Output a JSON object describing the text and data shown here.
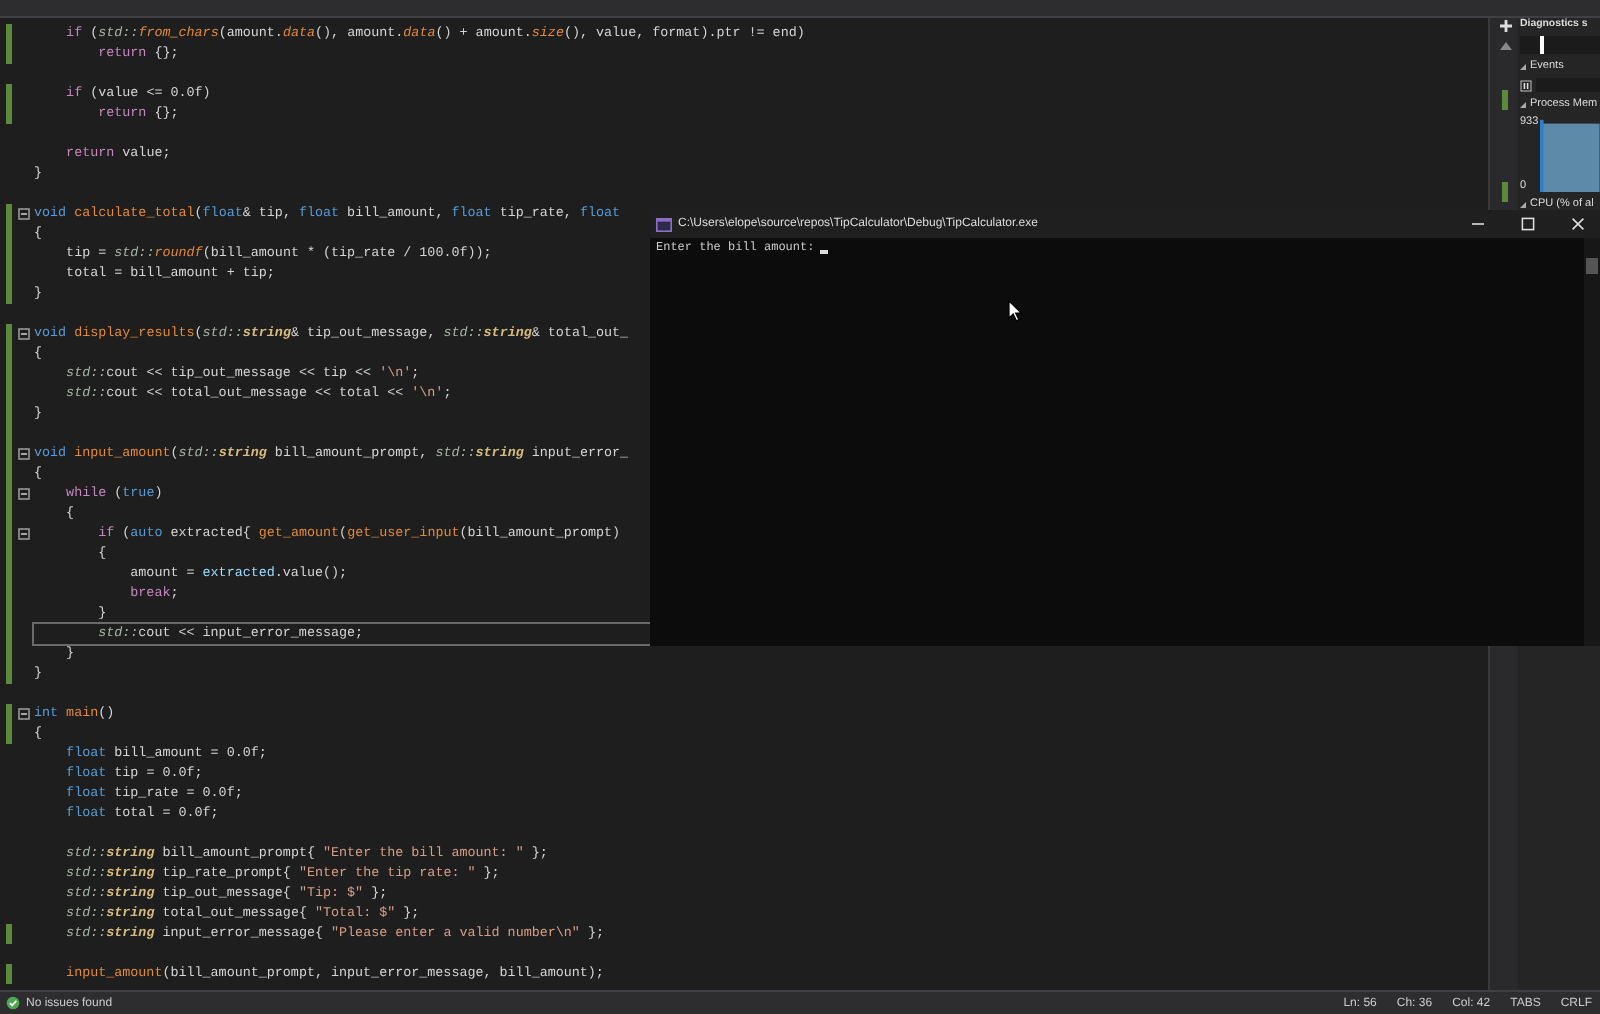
{
  "editor": {
    "lines": [
      {
        "changed": true,
        "fold": false,
        "current": false,
        "segs": [
          {
            "kind": "c",
            "text": "    if"
          },
          {
            "kind": "p",
            "text": " ("
          },
          {
            "kind": "n",
            "text": "std::"
          },
          {
            "kind": "m",
            "text": "from_chars"
          },
          {
            "kind": "p",
            "text": "(amount."
          },
          {
            "kind": "m",
            "text": "data"
          },
          {
            "kind": "p",
            "text": "(), amount."
          },
          {
            "kind": "m",
            "text": "data"
          },
          {
            "kind": "p",
            "text": "() + amount."
          },
          {
            "kind": "m",
            "text": "size"
          },
          {
            "kind": "p",
            "text": "(), value, format).ptr != end)"
          }
        ]
      },
      {
        "changed": true,
        "fold": false,
        "current": false,
        "segs": [
          {
            "kind": "c",
            "text": "        return"
          },
          {
            "kind": "p",
            "text": " {};"
          }
        ]
      },
      {
        "changed": false,
        "fold": false,
        "current": false
      },
      {
        "changed": true,
        "fold": false,
        "current": false,
        "segs": [
          {
            "kind": "c",
            "text": "    if"
          },
          {
            "kind": "p",
            "text": " (value <= 0.0f)"
          }
        ]
      },
      {
        "changed": true,
        "fold": false,
        "current": false,
        "segs": [
          {
            "kind": "c",
            "text": "        return"
          },
          {
            "kind": "p",
            "text": " {};"
          }
        ]
      },
      {
        "changed": false,
        "fold": false,
        "current": false
      },
      {
        "changed": false,
        "fold": false,
        "current": false,
        "segs": [
          {
            "kind": "c",
            "text": "    return"
          },
          {
            "kind": "p",
            "text": " value;"
          }
        ]
      },
      {
        "changed": false,
        "fold": false,
        "current": false,
        "segs": [
          {
            "kind": "p",
            "text": "}"
          }
        ]
      },
      {
        "changed": false,
        "fold": false,
        "current": false
      },
      {
        "changed": true,
        "fold": true,
        "current": false,
        "segs": [
          {
            "kind": "k",
            "text": "void"
          },
          {
            "kind": "f",
            "text": " calculate_total"
          },
          {
            "kind": "p",
            "text": "("
          },
          {
            "kind": "k",
            "text": "float"
          },
          {
            "kind": "p",
            "text": "& tip, "
          },
          {
            "kind": "k",
            "text": "float"
          },
          {
            "kind": "p",
            "text": " bill_amount, "
          },
          {
            "kind": "k",
            "text": "float"
          },
          {
            "kind": "p",
            "text": " tip_rate, "
          },
          {
            "kind": "k",
            "text": "float"
          }
        ]
      },
      {
        "changed": true,
        "fold": false,
        "current": false,
        "segs": [
          {
            "kind": "p",
            "text": "{"
          }
        ]
      },
      {
        "changed": true,
        "fold": false,
        "current": false,
        "segs": [
          {
            "kind": "p",
            "text": "    tip = "
          },
          {
            "kind": "n",
            "text": "std::"
          },
          {
            "kind": "m",
            "text": "roundf"
          },
          {
            "kind": "p",
            "text": "(bill_amount * (tip_rate / 100.0f));"
          }
        ]
      },
      {
        "changed": true,
        "fold": false,
        "current": false,
        "segs": [
          {
            "kind": "p",
            "text": "    total = bill_amount + tip;"
          }
        ]
      },
      {
        "changed": true,
        "fold": false,
        "current": false,
        "segs": [
          {
            "kind": "p",
            "text": "}"
          }
        ]
      },
      {
        "changed": false,
        "fold": false,
        "current": false
      },
      {
        "changed": true,
        "fold": true,
        "current": false,
        "segs": [
          {
            "kind": "k",
            "text": "void"
          },
          {
            "kind": "f",
            "text": " display_results"
          },
          {
            "kind": "p",
            "text": "("
          },
          {
            "kind": "n",
            "text": "std::"
          },
          {
            "kind": "t",
            "text": "string"
          },
          {
            "kind": "p",
            "text": "& tip_out_message, "
          },
          {
            "kind": "n",
            "text": "std::"
          },
          {
            "kind": "t",
            "text": "string"
          },
          {
            "kind": "p",
            "text": "& total_out_"
          }
        ]
      },
      {
        "changed": true,
        "fold": false,
        "current": false,
        "segs": [
          {
            "kind": "p",
            "text": "{"
          }
        ]
      },
      {
        "changed": true,
        "fold": false,
        "current": false,
        "segs": [
          {
            "kind": "n",
            "text": "    std::"
          },
          {
            "kind": "p",
            "text": "cout << tip_out_message << tip << "
          },
          {
            "kind": "s",
            "text": "'\\n'"
          },
          {
            "kind": "p",
            "text": ";"
          }
        ]
      },
      {
        "changed": true,
        "fold": false,
        "current": false,
        "segs": [
          {
            "kind": "n",
            "text": "    std::"
          },
          {
            "kind": "p",
            "text": "cout << total_out_message << total << "
          },
          {
            "kind": "s",
            "text": "'\\n'"
          },
          {
            "kind": "p",
            "text": ";"
          }
        ]
      },
      {
        "changed": true,
        "fold": false,
        "current": false,
        "segs": [
          {
            "kind": "p",
            "text": "}"
          }
        ]
      },
      {
        "changed": true,
        "fold": false
      },
      {
        "changed": true,
        "fold": true,
        "current": false,
        "segs": [
          {
            "kind": "k",
            "text": "void"
          },
          {
            "kind": "f",
            "text": " input_amount"
          },
          {
            "kind": "p",
            "text": "("
          },
          {
            "kind": "n",
            "text": "std::"
          },
          {
            "kind": "t",
            "text": "string"
          },
          {
            "kind": "p",
            "text": " bill_amount_prompt, "
          },
          {
            "kind": "n",
            "text": "std::"
          },
          {
            "kind": "t",
            "text": "string"
          },
          {
            "kind": "p",
            "text": " input_error_"
          }
        ]
      },
      {
        "changed": true,
        "fold": false,
        "current": false,
        "segs": [
          {
            "kind": "p",
            "text": "{"
          }
        ]
      },
      {
        "changed": true,
        "fold": true,
        "current": false,
        "segs": [
          {
            "kind": "c",
            "text": "    while"
          },
          {
            "kind": "p",
            "text": " ("
          },
          {
            "kind": "k",
            "text": "true"
          },
          {
            "kind": "p",
            "text": ")"
          }
        ]
      },
      {
        "changed": true,
        "fold": false,
        "current": false,
        "segs": [
          {
            "kind": "p",
            "text": "    {"
          }
        ]
      },
      {
        "changed": true,
        "fold": true,
        "current": false,
        "segs": [
          {
            "kind": "c",
            "text": "        if"
          },
          {
            "kind": "p",
            "text": " ("
          },
          {
            "kind": "k",
            "text": "auto"
          },
          {
            "kind": "p",
            "text": " extracted{ "
          },
          {
            "kind": "f",
            "text": "get_amount"
          },
          {
            "kind": "p",
            "text": "("
          },
          {
            "kind": "f",
            "text": "get_user_input"
          },
          {
            "kind": "p",
            "text": "(bill_amount_prompt)"
          }
        ]
      },
      {
        "changed": true,
        "fold": false,
        "current": false,
        "segs": [
          {
            "kind": "p",
            "text": "        {"
          }
        ]
      },
      {
        "changed": true,
        "fold": false,
        "current": false,
        "segs": [
          {
            "kind": "p",
            "text": "            amount = "
          },
          {
            "kind": "v",
            "text": "extracted"
          },
          {
            "kind": "p",
            "text": ".value();"
          }
        ]
      },
      {
        "changed": true,
        "fold": false,
        "current": false,
        "segs": [
          {
            "kind": "c",
            "text": "            break"
          },
          {
            "kind": "p",
            "text": ";"
          }
        ]
      },
      {
        "changed": true,
        "fold": false,
        "current": false,
        "segs": [
          {
            "kind": "p",
            "text": "        }"
          }
        ]
      },
      {
        "changed": true,
        "fold": false,
        "current": true,
        "segs": [
          {
            "kind": "n",
            "text": "        std::"
          },
          {
            "kind": "p",
            "text": "cout << input_error_message;"
          }
        ]
      },
      {
        "changed": true,
        "fold": false,
        "current": false,
        "segs": [
          {
            "kind": "p",
            "text": "    }"
          }
        ]
      },
      {
        "changed": true,
        "fold": false,
        "current": false,
        "segs": [
          {
            "kind": "p",
            "text": "}"
          }
        ]
      },
      {
        "changed": false,
        "fold": false,
        "current": false
      },
      {
        "changed": true,
        "fold": true,
        "current": false,
        "segs": [
          {
            "kind": "k",
            "text": "int"
          },
          {
            "kind": "f",
            "text": " main"
          },
          {
            "kind": "p",
            "text": "()"
          }
        ]
      },
      {
        "changed": true,
        "fold": false,
        "current": false,
        "segs": [
          {
            "kind": "p",
            "text": "{"
          }
        ]
      },
      {
        "changed": false,
        "fold": false,
        "current": false,
        "segs": [
          {
            "kind": "k",
            "text": "    float"
          },
          {
            "kind": "p",
            "text": " bill_amount = 0.0f;"
          }
        ]
      },
      {
        "changed": false,
        "fold": false,
        "current": false,
        "segs": [
          {
            "kind": "k",
            "text": "    float"
          },
          {
            "kind": "p",
            "text": " tip = 0.0f;"
          }
        ]
      },
      {
        "changed": false,
        "fold": false,
        "current": false,
        "segs": [
          {
            "kind": "k",
            "text": "    float"
          },
          {
            "kind": "p",
            "text": " tip_rate = 0.0f;"
          }
        ]
      },
      {
        "changed": false,
        "fold": false,
        "current": false,
        "segs": [
          {
            "kind": "k",
            "text": "    float"
          },
          {
            "kind": "p",
            "text": " total = 0.0f;"
          }
        ]
      },
      {
        "changed": false,
        "fold": false,
        "current": false
      },
      {
        "changed": false,
        "fold": false,
        "current": false,
        "segs": [
          {
            "kind": "n",
            "text": "    std::"
          },
          {
            "kind": "t",
            "text": "string"
          },
          {
            "kind": "p",
            "text": " bill_amount_prompt{ "
          },
          {
            "kind": "s",
            "text": "\"Enter the bill amount: \""
          },
          {
            "kind": "p",
            "text": " };"
          }
        ]
      },
      {
        "changed": false,
        "fold": false,
        "current": false,
        "segs": [
          {
            "kind": "n",
            "text": "    std::"
          },
          {
            "kind": "t",
            "text": "string"
          },
          {
            "kind": "p",
            "text": " tip_rate_prompt{ "
          },
          {
            "kind": "s",
            "text": "\"Enter the tip rate: \""
          },
          {
            "kind": "p",
            "text": " };"
          }
        ]
      },
      {
        "changed": false,
        "fold": false,
        "current": false,
        "segs": [
          {
            "kind": "n",
            "text": "    std::"
          },
          {
            "kind": "t",
            "text": "string"
          },
          {
            "kind": "p",
            "text": " tip_out_message{ "
          },
          {
            "kind": "s",
            "text": "\"Tip: $\""
          },
          {
            "kind": "p",
            "text": " };"
          }
        ]
      },
      {
        "changed": false,
        "fold": false,
        "current": false,
        "segs": [
          {
            "kind": "n",
            "text": "    std::"
          },
          {
            "kind": "t",
            "text": "string"
          },
          {
            "kind": "p",
            "text": " total_out_message{ "
          },
          {
            "kind": "s",
            "text": "\"Total: $\""
          },
          {
            "kind": "p",
            "text": " };"
          }
        ]
      },
      {
        "changed": true,
        "fold": false,
        "current": false,
        "segs": [
          {
            "kind": "n",
            "text": "    std::"
          },
          {
            "kind": "t",
            "text": "string"
          },
          {
            "kind": "p",
            "text": " input_error_message{ "
          },
          {
            "kind": "s",
            "text": "\"Please enter a valid number\\n\""
          },
          {
            "kind": "p",
            "text": " };"
          }
        ]
      },
      {
        "changed": false,
        "fold": false,
        "current": false
      },
      {
        "changed": true,
        "fold": false,
        "current": false,
        "segs": [
          {
            "kind": "f",
            "text": "    input_amount"
          },
          {
            "kind": "p",
            "text": "(bill_amount_prompt, input_error_message, bill_amount);"
          }
        ]
      }
    ]
  },
  "diagnostics": {
    "title": "Diagnostics s",
    "events": "Events",
    "memory": "Process Mem",
    "memory_max": "933",
    "memory_min": "0",
    "cpu": "CPU (% of al"
  },
  "console": {
    "title": "C:\\Users\\elope\\source\\repos\\TipCalculator\\Debug\\TipCalculator.exe",
    "output": "Enter the bill amount:"
  },
  "status_bar": {
    "message": "No issues found",
    "items": [
      "Ln: 56",
      "Ch: 36",
      "Col: 42",
      "TABS",
      "CRLF"
    ]
  }
}
